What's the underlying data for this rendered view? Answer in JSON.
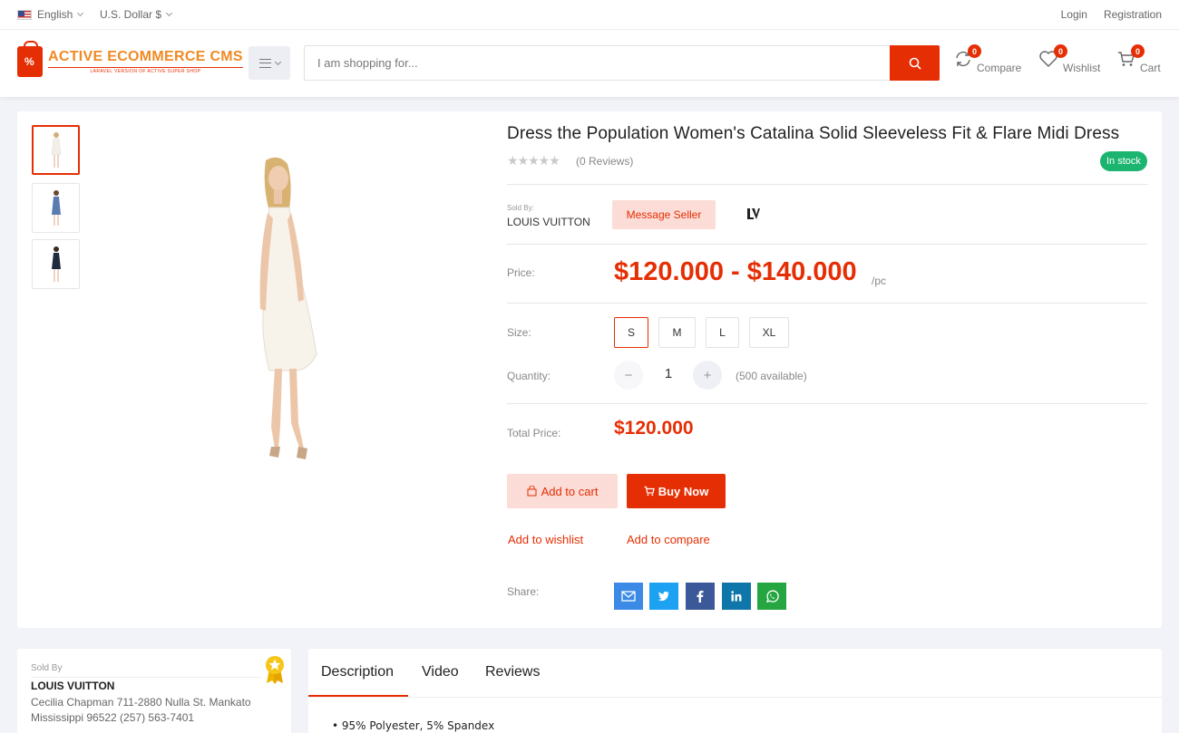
{
  "topbar": {
    "language": "English",
    "currency": "U.S. Dollar $",
    "login": "Login",
    "registration": "Registration"
  },
  "header": {
    "logo_title": "ACTIVE ECOMMERCE CMS",
    "logo_subtitle": "LARAVEL VERSION OF ACTIVE SUPER SHOP",
    "search_placeholder": "I am shopping for...",
    "compare": {
      "label": "Compare",
      "count": "0"
    },
    "wishlist": {
      "label": "Wishlist",
      "count": "0"
    },
    "cart": {
      "label": "Cart",
      "count": "0"
    }
  },
  "product": {
    "title": "Dress the Population Women's Catalina Solid Sleeveless Fit & Flare Midi Dress",
    "stars": "★★★★★",
    "reviews": "(0 Reviews)",
    "stock": "In stock",
    "sold_by_label": "Sold By:",
    "seller": "LOUIS VUITTON",
    "message_seller": "Message Seller",
    "brand_logo": "LV",
    "price_label": "Price:",
    "price": "$120.000 - $140.000",
    "unit": "/pc",
    "size_label": "Size:",
    "sizes": [
      "S",
      "M",
      "L",
      "XL"
    ],
    "selected_size": "S",
    "quantity_label": "Quantity:",
    "quantity": "1",
    "available": "(500 available)",
    "total_label": "Total Price:",
    "total": "$120.000",
    "add_to_cart": "Add to cart",
    "buy_now": "Buy Now",
    "add_to_wishlist": "Add to wishlist",
    "add_to_compare": "Add to compare",
    "share_label": "Share:",
    "share_icons": [
      "email-icon",
      "twitter-icon",
      "facebook-icon",
      "linkedin-icon",
      "whatsapp-icon"
    ]
  },
  "seller_card": {
    "label": "Sold By",
    "name": "LOUIS VUITTON",
    "address": "Cecilia Chapman 711-2880 Nulla St. Mankato Mississippi 96522 (257) 563-7401"
  },
  "tabs": [
    "Description",
    "Video",
    "Reviews"
  ],
  "description_items": [
    "95% Polyester, 5% Spandex"
  ],
  "colors": {
    "accent": "#e62e04",
    "accent_soft": "#fbdcd7",
    "stock_green": "#1cb56f",
    "email": "#3b8be6",
    "twitter": "#1da1f2",
    "facebook": "#3b5998",
    "linkedin": "#0e76a8",
    "whatsapp": "#25a641"
  }
}
